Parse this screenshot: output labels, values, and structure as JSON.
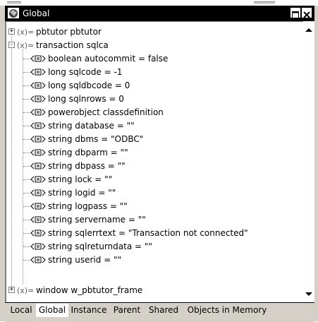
{
  "window": {
    "title": "Global"
  },
  "tree": {
    "items": [
      {
        "text": "pbtutor pbtutor",
        "expander": "+"
      },
      {
        "text": "transaction sqlca",
        "expander": "-"
      },
      {
        "text": "boolean autocommit = false"
      },
      {
        "text": "long sqlcode = -1"
      },
      {
        "text": "long sqldbcode = 0"
      },
      {
        "text": "long sqlnrows = 0"
      },
      {
        "text": "powerobject classdefinition"
      },
      {
        "text": "string database = \"\""
      },
      {
        "text": "string dbms = \"ODBC\""
      },
      {
        "text": "string dbparm = \"\""
      },
      {
        "text": "string dbpass = \"\""
      },
      {
        "text": "string lock = \"\""
      },
      {
        "text": "string logid = \"\""
      },
      {
        "text": "string logpass = \"\""
      },
      {
        "text": "string servername = \"\""
      },
      {
        "text": "string sqlerrtext = \"Transaction not connected\""
      },
      {
        "text": "string sqlreturndata = \"\""
      },
      {
        "text": "string userid = \"\""
      },
      {
        "text": "window w_pbtutor_frame",
        "expander": "+"
      }
    ],
    "variable_icon": "(x)=",
    "property_icon": "property-icon"
  },
  "tabs": [
    {
      "label": "Local"
    },
    {
      "label": "Global",
      "active": true
    },
    {
      "label": "Instance"
    },
    {
      "label": "Parent"
    },
    {
      "label": "Shared"
    },
    {
      "label": "Objects in Memory"
    }
  ]
}
